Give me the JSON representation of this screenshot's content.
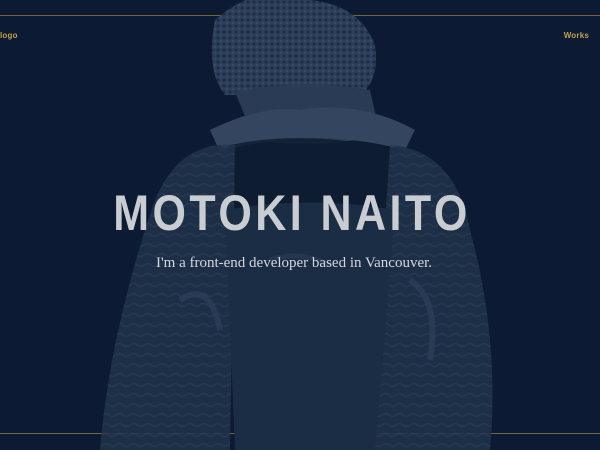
{
  "nav": {
    "left_label": "logo",
    "right_label": "Works"
  },
  "hero": {
    "title": "MOTOKI NAITO",
    "subtitle": "I'm a front-end developer based in Vancouver."
  },
  "colors": {
    "background": "#0c1a33",
    "accent": "#c2a04a",
    "title": "#c9ccd1"
  }
}
